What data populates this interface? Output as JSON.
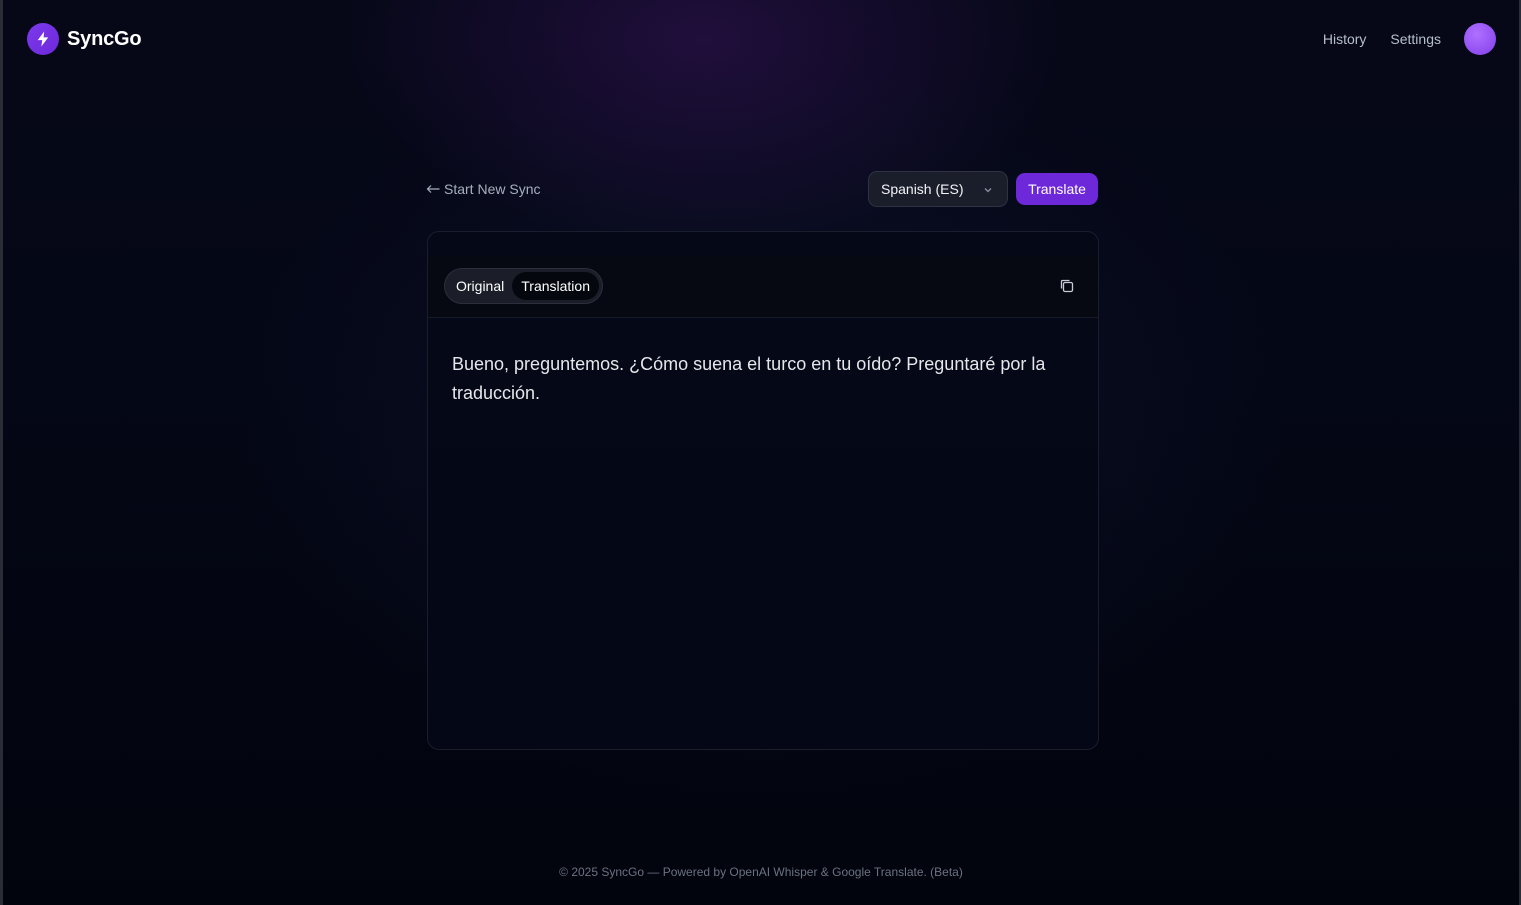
{
  "app": {
    "name": "SyncGo",
    "logo_icon": "lightning-bolt-icon",
    "accent_color": "#6d28d9"
  },
  "nav": {
    "items": [
      {
        "label": "History"
      },
      {
        "label": "Settings"
      }
    ],
    "avatar_icon": "user-avatar"
  },
  "toolbar": {
    "back_label": "Start New Sync",
    "back_icon": "arrow-left-icon",
    "language_selected": "Spanish (ES)",
    "translate_label": "Translate"
  },
  "card": {
    "tabs": [
      {
        "label": "Original",
        "active": false
      },
      {
        "label": "Translation",
        "active": true
      }
    ],
    "copy_icon": "copy-icon",
    "text": "Bueno, preguntemos. ¿Cómo suena el turco en tu oído? Preguntaré por la traducción."
  },
  "footer": {
    "text": "© 2025 SyncGo — Powered by OpenAI Whisper & Google Translate. (Beta)"
  }
}
